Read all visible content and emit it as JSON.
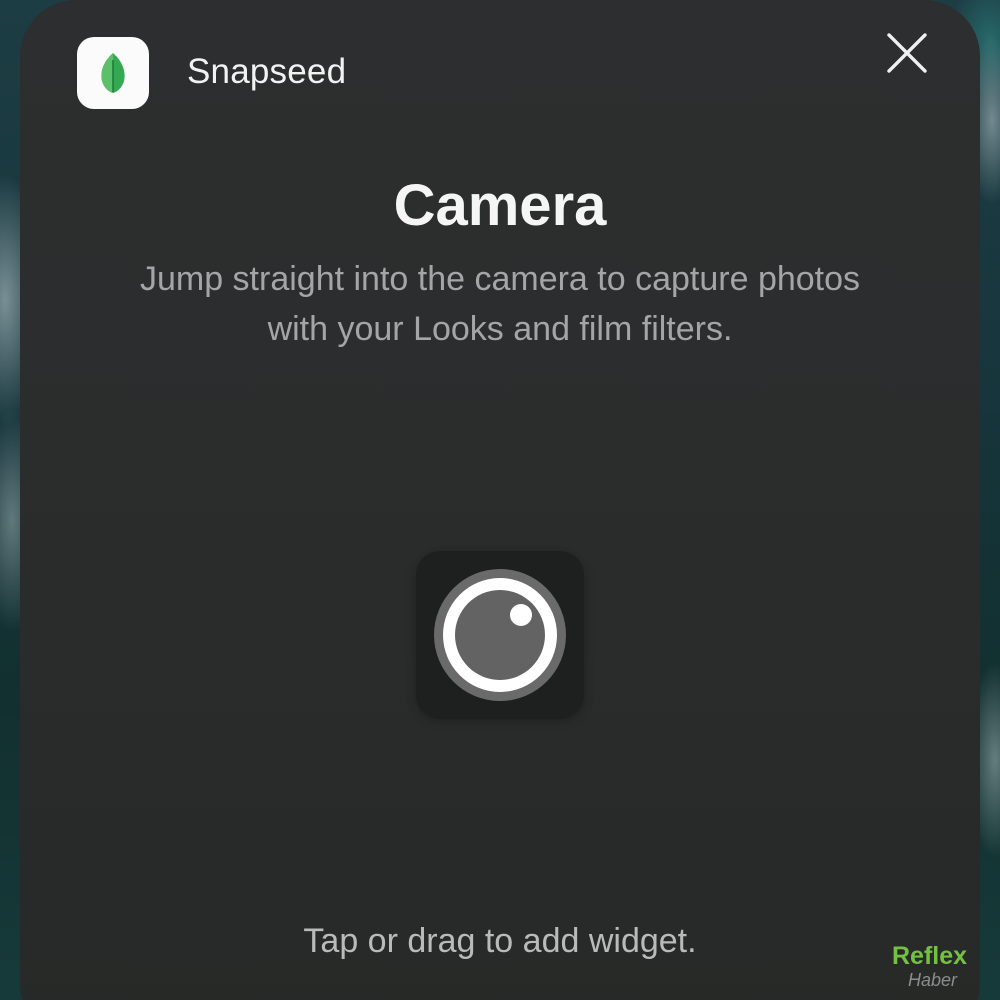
{
  "app": {
    "name": "Snapseed",
    "icon": "snapseed-leaf-icon"
  },
  "widget": {
    "title": "Camera",
    "description_lines": [
      "Jump straight into the camera to capture photos",
      "with your Looks and film filters."
    ],
    "preview_icon": "camera-lens-icon"
  },
  "hint": "Tap or drag to add widget.",
  "close_icon": "close-icon",
  "watermark": {
    "brand": "Reflex",
    "sub": "Haber"
  },
  "colors": {
    "sheet": "#2c2e2f",
    "leaf_green": "#34a853",
    "watermark_green": "#74c043"
  }
}
